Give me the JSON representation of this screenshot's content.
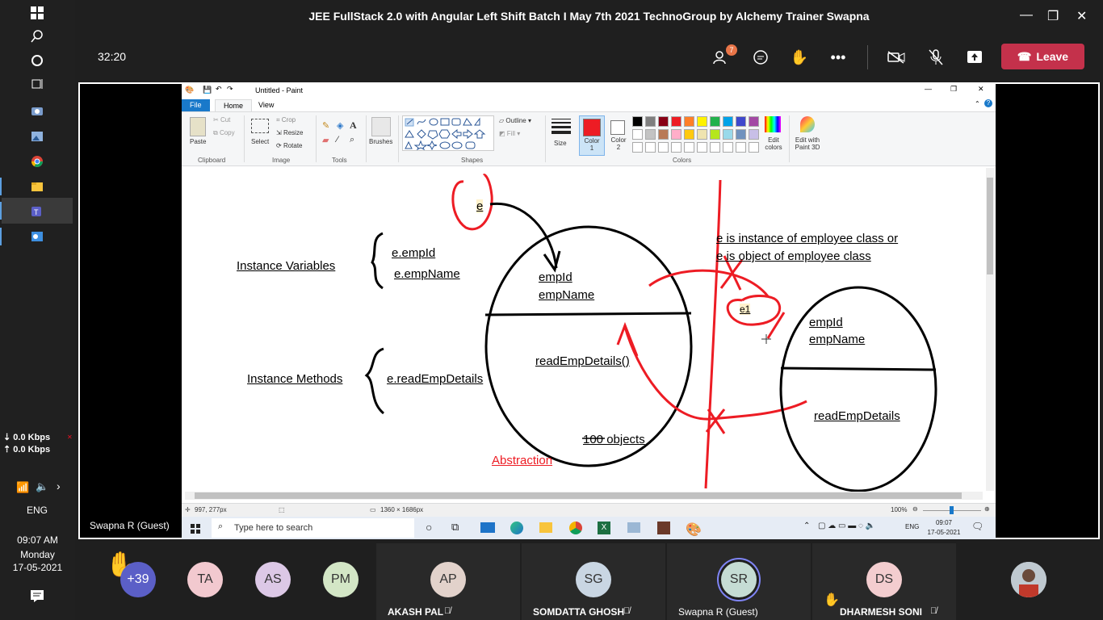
{
  "os_taskbar": {
    "icons": [
      "windows-logo-icon",
      "search-icon",
      "cortana-icon",
      "task-view-icon",
      "camera-icon",
      "photos-icon",
      "chrome-icon",
      "file-explorer-icon",
      "teams-icon",
      "outlook-icon"
    ],
    "net_down": "⇣ 0.0 Kbps",
    "net_up": "⇡ 0.0 Kbps",
    "lang": "ENG",
    "time": "09:07 AM",
    "day": "Monday",
    "date": "17-05-2021"
  },
  "window": {
    "title": "JEE FullStack 2.0 with Angular Left Shift Batch I May 7th 2021 TechnoGroup by Alchemy Trainer Swapna"
  },
  "meeting": {
    "timer": "32:20",
    "participants_badge": "7",
    "leave_label": "Leave"
  },
  "paint": {
    "title": "Untitled - Paint",
    "tabs": [
      "File",
      "Home",
      "View"
    ],
    "clipboard": {
      "paste": "Paste",
      "cut": "Cut",
      "copy": "Copy",
      "group": "Clipboard"
    },
    "image": {
      "select": "Select",
      "crop": "Crop",
      "resize": "Resize",
      "rotate": "Rotate",
      "group": "Image"
    },
    "tools_group": "Tools",
    "brushes": "Brushes",
    "shapes": {
      "outline": "Outline",
      "fill": "Fill",
      "group": "Shapes"
    },
    "size": "Size",
    "color1": "Color\n1",
    "color2": "Color\n2",
    "colors_group": "Colors",
    "edit_colors": "Edit colors",
    "edit_paint3d": "Edit with Paint 3D",
    "palette_row1": [
      "#000000",
      "#7f7f7f",
      "#880015",
      "#ed1c24",
      "#ff7f27",
      "#fff200",
      "#22b14c",
      "#00a2e8",
      "#3f48cc",
      "#a349a4"
    ],
    "palette_row2": [
      "#ffffff",
      "#c3c3c3",
      "#b97a57",
      "#ffaec9",
      "#ffc90e",
      "#efe4b0",
      "#b5e61d",
      "#99d9ea",
      "#7092be",
      "#c8bfe7"
    ],
    "status_pos": "997, 277px",
    "status_size": "1360 × 1686px",
    "zoom": "100%"
  },
  "drawing": {
    "e": "e",
    "instance_variables": "Instance Variables",
    "e_empid": "e.empId",
    "e_empname": "e.empName",
    "instance_methods": "Instance Methods",
    "e_read": "e.readEmpDetails",
    "empid_1": "empId",
    "empname_1": "empName",
    "read_1": "readEmpDetails()",
    "objects": "100 objects",
    "abstraction": "Abstraction",
    "note_line1": "e is instance of employee class or",
    "note_line2": "e is object of employee class",
    "e1": "e1",
    "empid_2": "empId",
    "empname_2": "empName",
    "read_2": "readEmpDetails"
  },
  "inner_taskbar": {
    "search_placeholder": "Type here to search",
    "lang": "ENG",
    "time": "09:07",
    "date": "17-05-2021"
  },
  "presenter_label": "Swapna R (Guest)",
  "participants": {
    "overflow": "+39",
    "avatars": [
      {
        "initials": "TA",
        "color": "#f2c9cf"
      },
      {
        "initials": "AS",
        "color": "#dcc8e6"
      },
      {
        "initials": "PM",
        "color": "#d3e6c6"
      }
    ],
    "tiles": [
      {
        "initials": "AP",
        "name": "AKASH PAL",
        "color": "#e2d2cb"
      },
      {
        "initials": "SG",
        "name": "SOMDATTA GHOSH",
        "color": "#c9d6e3"
      },
      {
        "initials": "SR",
        "name": "Swapna R (Guest)",
        "color": "#c5dcd4"
      },
      {
        "initials": "DS",
        "name": "DHARMESH SONI",
        "color": "#f3cdcf"
      }
    ]
  }
}
